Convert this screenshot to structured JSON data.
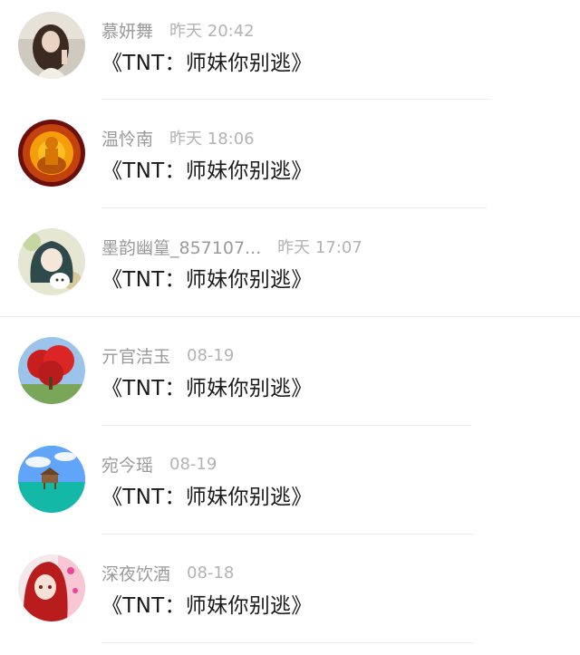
{
  "comments": [
    {
      "name": "慕妍舞",
      "time": "昨天 20:42",
      "text": "《TNT：师妹你别逃》",
      "avatar": "girl-portrait-avatar"
    },
    {
      "name": "温怜南",
      "time": "昨天 18:06",
      "text": "《TNT：师妹你别逃》",
      "avatar": "golden-buddha-avatar"
    },
    {
      "name": "墨韵幽篁_857107...",
      "time": "昨天 17:07",
      "text": "《TNT：师妹你别逃》",
      "avatar": "anime-girl-dog-avatar"
    },
    {
      "name": "亓官洁玉",
      "time": "08-19",
      "text": "《TNT：师妹你别逃》",
      "avatar": "red-tree-avatar"
    },
    {
      "name": "宛今瑶",
      "time": "08-19",
      "text": "《TNT：师妹你别逃》",
      "avatar": "sea-hut-avatar"
    },
    {
      "name": "深夜饮酒",
      "time": "08-18",
      "text": "《TNT：师妹你别逃》",
      "avatar": "red-hair-anime-avatar"
    }
  ]
}
